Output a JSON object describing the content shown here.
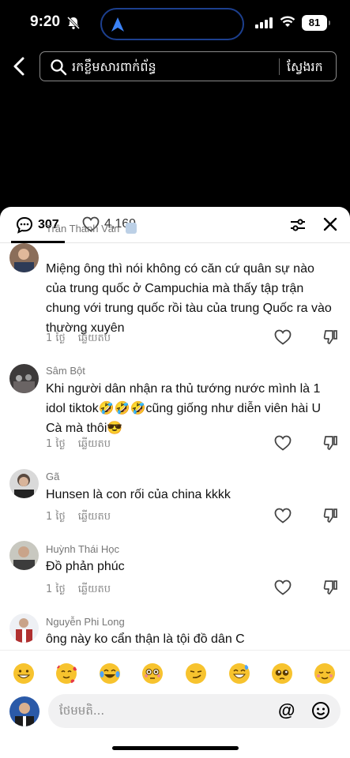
{
  "status": {
    "time": "9:20",
    "battery": "81"
  },
  "search": {
    "placeholder": "រកខ្លឹមសារពាក់ព័ន្ធ",
    "button": "ស្វែងរក"
  },
  "panel": {
    "comment_count": "307",
    "like_count": "4,169"
  },
  "comments": [
    {
      "name": "Trần Thanh Vân",
      "text": "Miệng ông thì nói không có căn cứ quân sự nào của trung quốc ở Campuchia mà thấy tập trận chung với trung quốc rồi tàu của trung Quốc ra vào thường xuyên",
      "time": "1 ថ្ងៃ",
      "reply": "ឆ្លើយតប"
    },
    {
      "name": "Sâm Bột",
      "text": "Khi người dân nhận ra thủ tướng nước mình là 1 idol tiktok🤣🤣🤣cũng giống như diễn viên hài U Cà mà thôi😎",
      "time": "1 ថ្ងៃ",
      "reply": "ឆ្លើយតប"
    },
    {
      "name": "Gã",
      "text": "Hunsen là con rối của china kkkk",
      "time": "1 ថ្ងៃ",
      "reply": "ឆ្លើយតប"
    },
    {
      "name": "Huỳnh Thái Học",
      "text": "Đồ phản phúc",
      "time": "1 ថ្ងៃ",
      "reply": "ឆ្លើយតប"
    },
    {
      "name": "Nguyễn Phi Long",
      "text": "ông này ko cẩn thận là tội đồ dân C",
      "time": "",
      "reply": ""
    }
  ],
  "emojis": [
    "grinning",
    "smiling-hearts",
    "tears-of-joy",
    "flushed",
    "smirk",
    "sweat-smile",
    "pleading",
    "relieved"
  ],
  "input": {
    "placeholder": "ថែមមតិ..."
  },
  "colors": {
    "island_border": "#1c3f8e",
    "emoji_yellow": "#f7c32e"
  }
}
